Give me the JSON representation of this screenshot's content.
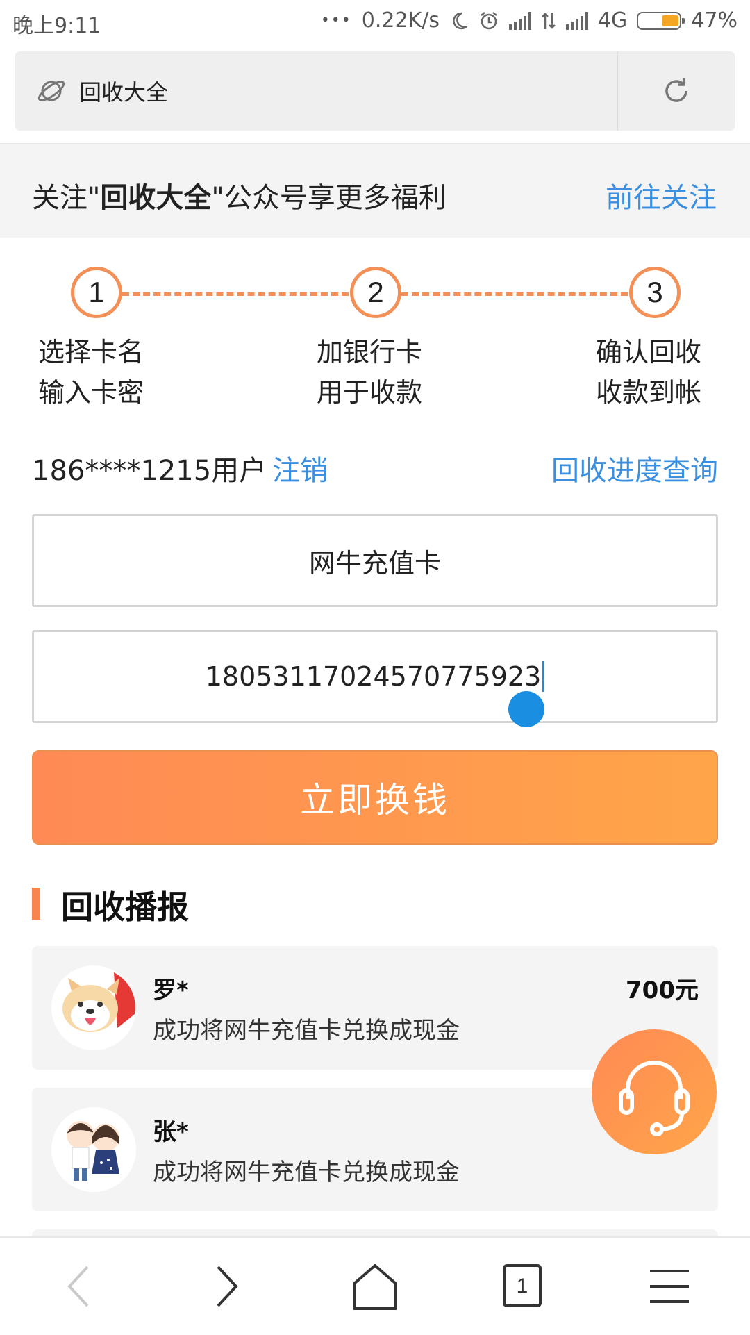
{
  "status_bar": {
    "time": "晚上9:11",
    "dots": "•••",
    "speed": "0.22K/s",
    "network": "4G",
    "battery": "47%"
  },
  "address_bar": {
    "title": "回收大全",
    "icons": {
      "site": "planet-icon",
      "reload": "refresh-icon"
    }
  },
  "follow_banner": {
    "prefix": "关注\"",
    "brand": "回收大全",
    "suffix": "\"公众号享更多福利",
    "action": "前往关注"
  },
  "steps": [
    {
      "num": "1",
      "line1": "选择卡名",
      "line2": "输入卡密"
    },
    {
      "num": "2",
      "line1": "加银行卡",
      "line2": "用于收款"
    },
    {
      "num": "3",
      "line1": "确认回收",
      "line2": "收款到帐"
    }
  ],
  "user": {
    "phone": "186****1215用户",
    "logout": "注销",
    "progress_query": "回收进度查询"
  },
  "form": {
    "card_name": "网牛充值卡",
    "card_secret": "18053117024570775923",
    "submit": "立即换钱"
  },
  "broadcast": {
    "title": "回收播报",
    "items": [
      {
        "name": "罗*",
        "desc": "成功将网牛充值卡兑换成现金",
        "amount": "700元"
      },
      {
        "name": "张*",
        "desc": "成功将网牛充值卡兑换成现金",
        "amount": ""
      }
    ]
  },
  "bottom_nav": {
    "tabs_count": "1",
    "icons": [
      "back-icon",
      "forward-icon",
      "home-icon",
      "tabs-icon",
      "menu-icon"
    ]
  },
  "colors": {
    "accent": "#f29057",
    "link": "#3b8fe0",
    "button_start": "#ff8a55",
    "button_end": "#ffa549"
  }
}
